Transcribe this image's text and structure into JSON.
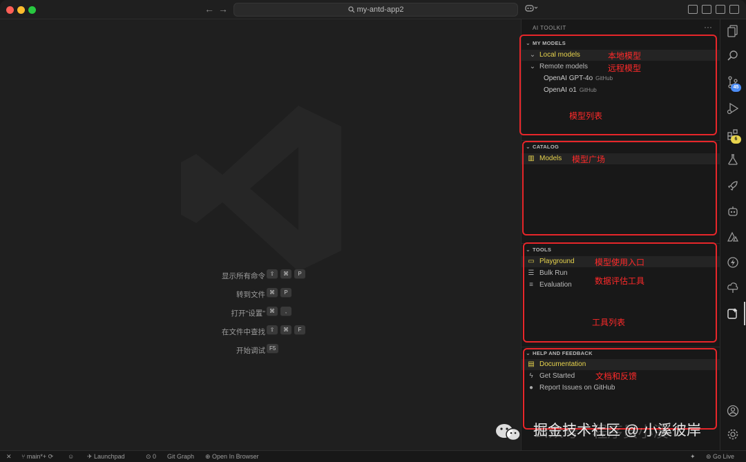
{
  "titlebar": {
    "project": "my-antd-app2"
  },
  "editor": {
    "shortcuts": [
      {
        "label": "显示所有命令",
        "keys": [
          "⇧",
          "⌘",
          "P"
        ]
      },
      {
        "label": "转到文件",
        "keys": [
          "⌘",
          "P"
        ]
      },
      {
        "label": "打开\"设置\"",
        "keys": [
          "⌘",
          ","
        ]
      },
      {
        "label": "在文件中查找",
        "keys": [
          "⇧",
          "⌘",
          "F"
        ]
      },
      {
        "label": "开始调试",
        "keys": [
          "F5"
        ]
      }
    ]
  },
  "panel": {
    "title": "AI TOOLKIT",
    "my_models": {
      "header": "MY MODELS",
      "local": "Local models",
      "remote": "Remote models",
      "models": [
        {
          "name": "OpenAI GPT-4o",
          "source": "GitHub"
        },
        {
          "name": "OpenAI o1",
          "source": "GitHub"
        }
      ]
    },
    "catalog": {
      "header": "CATALOG",
      "models": "Models"
    },
    "tools": {
      "header": "TOOLS",
      "playground": "Playground",
      "bulk_run": "Bulk Run",
      "evaluation": "Evaluation"
    },
    "help": {
      "header": "HELP AND FEEDBACK",
      "documentation": "Documentation",
      "get_started": "Get Started",
      "report": "Report Issues on GitHub"
    }
  },
  "annotations": {
    "local": "本地模型",
    "remote": "远程模型",
    "model_list": "模型列表",
    "catalog": "模型广场",
    "playground": "模型使用入口",
    "eval": "数据评估工具",
    "tool_list": "工具列表",
    "docs": "文档和反馈"
  },
  "activity": {
    "badge_scm": "45",
    "badge_ext": "6"
  },
  "status": {
    "branch": "main*+",
    "launchpad": "Launchpad",
    "ports": "0",
    "git_graph": "Git Graph",
    "open_browser": "Open In Browser",
    "go_live": "Go Live"
  },
  "watermark": {
    "main": "掘金技术社区 @ 小溪彼岸",
    "faint": "公众号 · 程序员小溪"
  },
  "colors": {
    "highlight": "#e8d44d",
    "annotation": "#e8262a",
    "badge_scm": "#4c8cf5",
    "badge_ext": "#e8d44d"
  }
}
